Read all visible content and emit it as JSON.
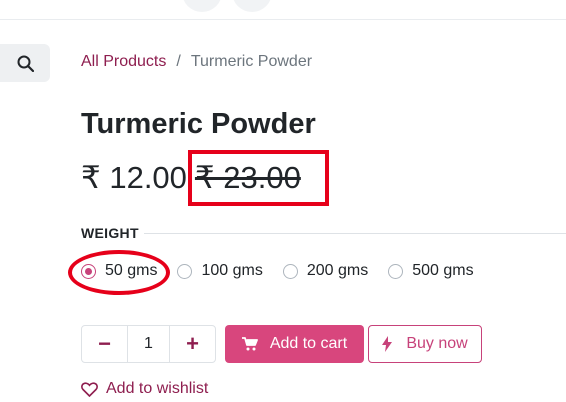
{
  "breadcrumb": {
    "link": "All Products",
    "separator": "/",
    "current": "Turmeric Powder"
  },
  "product": {
    "title": "Turmeric Powder",
    "price": "₹ 12.00",
    "old_price": "₹ 23.00"
  },
  "attribute": {
    "label": "WEIGHT",
    "options": [
      {
        "label": "50 gms",
        "selected": true
      },
      {
        "label": "100 gms",
        "selected": false
      },
      {
        "label": "200 gms",
        "selected": false
      },
      {
        "label": "500 gms",
        "selected": false
      }
    ]
  },
  "quantity": {
    "value": "1",
    "minus": "−",
    "plus": "+"
  },
  "actions": {
    "add_to_cart": "Add to cart",
    "buy_now": "Buy now",
    "wishlist": "Add to wishlist"
  },
  "colors": {
    "accent": "#d8467d",
    "link": "#8e1e4f",
    "annotation": "#e6001a"
  },
  "icons": [
    "search-icon",
    "cart-icon",
    "bolt-icon",
    "heart-icon"
  ]
}
